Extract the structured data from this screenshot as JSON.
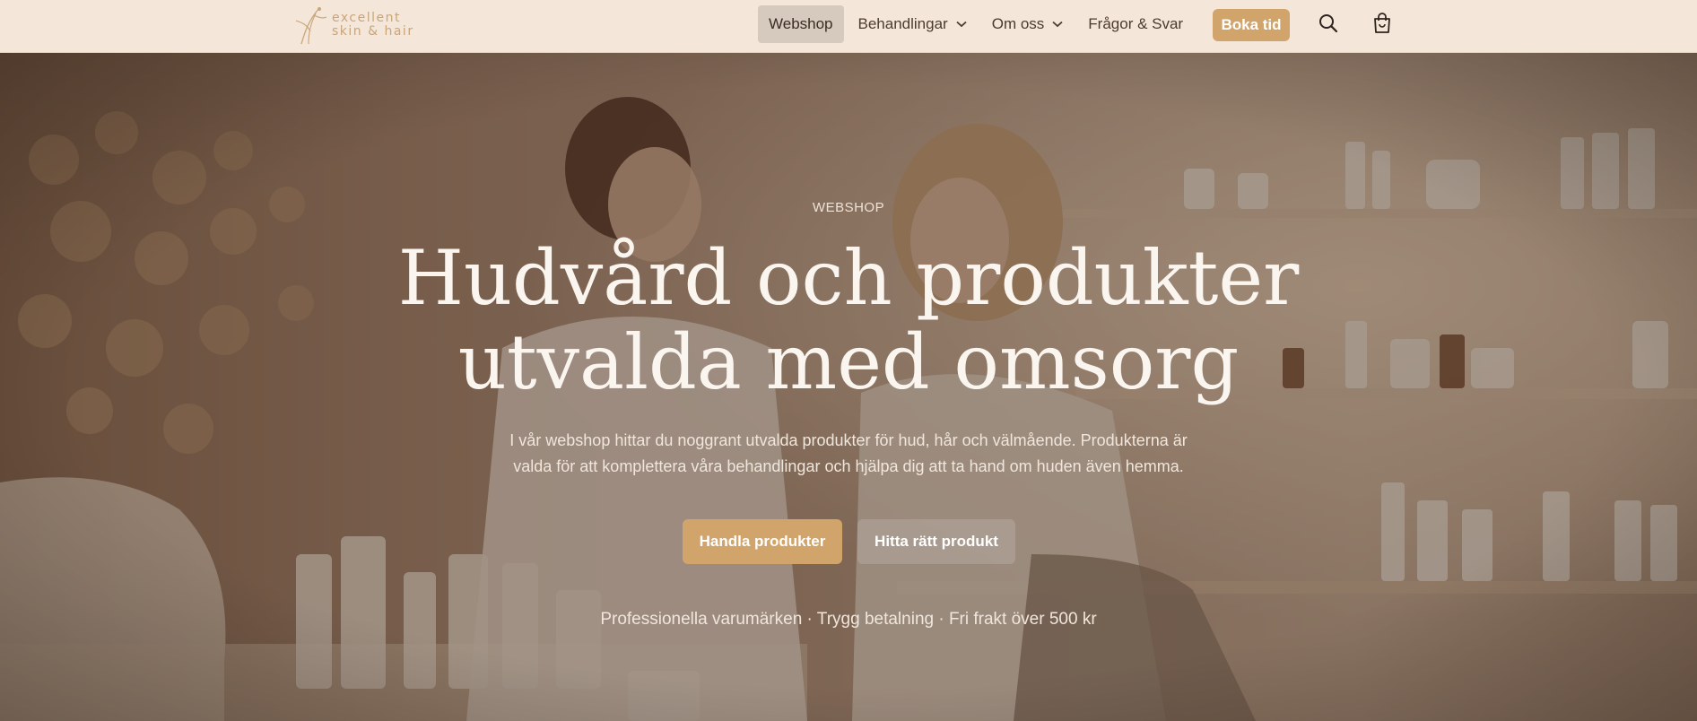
{
  "header": {
    "logo": {
      "line1": "excellent",
      "line2": "skin & hair"
    },
    "nav": [
      {
        "label": "Webshop",
        "active": true,
        "dropdown": false
      },
      {
        "label": "Behandlingar",
        "active": false,
        "dropdown": true
      },
      {
        "label": "Om oss",
        "active": false,
        "dropdown": true
      },
      {
        "label": "Frågor & Svar",
        "active": false,
        "dropdown": false
      }
    ],
    "book_label": "Boka tid",
    "icons": [
      "search-icon",
      "shopping-bag-icon"
    ]
  },
  "hero": {
    "eyebrow": "WEBSHOP",
    "headline_line1": "Hudvård och produkter",
    "headline_line2": "utvalda med omsorg",
    "lede_line1": "I vår webshop hittar du noggrant utvalda produkter för hud, hår och välmående. Produkterna är",
    "lede_line2": "valda för att komplettera våra behandlingar och hjälpa dig att ta hand om huden även hemma.",
    "primary_cta": "Handla produkter",
    "secondary_cta": "Hitta rätt produkt",
    "trust_line": "Professionella varumärken · Trygg betalning · Fri frakt över 500 kr"
  },
  "colors": {
    "header_bg": "#f4e6d8",
    "accent": "#d1a46c",
    "nav_active_bg": "#d6c9bd",
    "text_dark": "#4b3b30"
  }
}
